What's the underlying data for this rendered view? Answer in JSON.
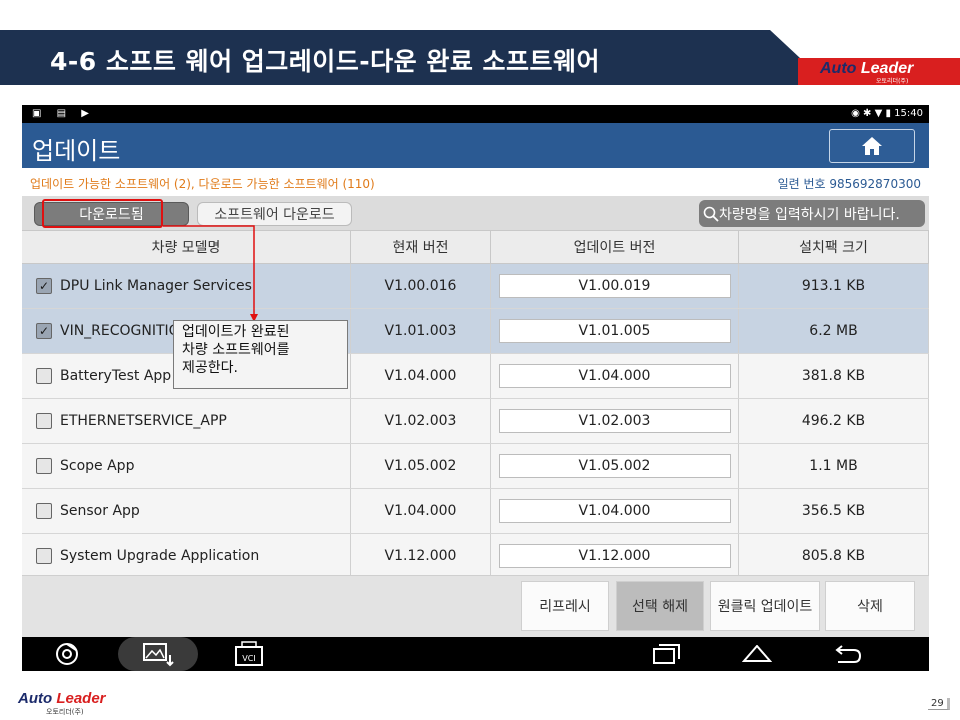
{
  "slide": {
    "title": "4-6 소프트 웨어 업그레이드-다운 완료 소프트웨어",
    "logo_text": "Auto Leader",
    "logo_sub": "오토리더(주)",
    "page_number": "29",
    "header_color": "#1d3150",
    "accent_color": "#d91f1f"
  },
  "status_bar": {
    "left_icons": [
      "image-icon",
      "sd-icon",
      "play-icon"
    ],
    "right_text": "15:40",
    "right_icons": [
      "location-icon",
      "bluetooth-icon",
      "wifi-icon",
      "battery-icon"
    ]
  },
  "app": {
    "title": "업데이트",
    "home_icon": "home-icon",
    "info_left": "업데이트 가능한 소프트웨어 (2), 다운로드 가능한 소프트웨어 (110)",
    "info_right": "일련 번호  985692870300",
    "tabs": [
      {
        "label": "다운로드됨",
        "active": true
      },
      {
        "label": "소프트웨어 다운로드",
        "active": false
      }
    ],
    "search_placeholder": "차량명을 입력하시기 바랍니다.",
    "columns": [
      "차량 모델명",
      "현재 버전",
      "업데이트 버전",
      "설치팩 크기"
    ],
    "rows": [
      {
        "name": "DPU Link Manager Services",
        "current": "V1.00.016",
        "update": "V1.00.019",
        "size": "913.1 KB",
        "checked": true
      },
      {
        "name": "VIN_RECOGNITIO",
        "current": "V1.01.003",
        "update": "V1.01.005",
        "size": "6.2 MB",
        "checked": true
      },
      {
        "name": "BatteryTest App",
        "current": "V1.04.000",
        "update": "V1.04.000",
        "size": "381.8 KB",
        "checked": false
      },
      {
        "name": "ETHERNETSERVICE_APP",
        "current": "V1.02.003",
        "update": "V1.02.003",
        "size": "496.2 KB",
        "checked": false
      },
      {
        "name": "Scope App",
        "current": "V1.05.002",
        "update": "V1.05.002",
        "size": "1.1 MB",
        "checked": false
      },
      {
        "name": "Sensor App",
        "current": "V1.04.000",
        "update": "V1.04.000",
        "size": "356.5 KB",
        "checked": false
      },
      {
        "name": "System Upgrade Application",
        "current": "V1.12.000",
        "update": "V1.12.000",
        "size": "805.8 KB",
        "checked": false
      }
    ],
    "buttons": {
      "refresh": "리프레시",
      "deselect": "선택 해제",
      "one_click_update": "원클릭 업데이트",
      "delete": "삭제"
    },
    "nav_icons": [
      "chrome-icon",
      "gallery-icon",
      "vci-icon",
      "recent-apps-icon",
      "home-nav-icon",
      "back-icon"
    ],
    "vci_label": "VCI"
  },
  "callout": {
    "line1": "업데이트가 완료된",
    "line2": "차량 소프트웨어를",
    "line3": "제공한다."
  }
}
